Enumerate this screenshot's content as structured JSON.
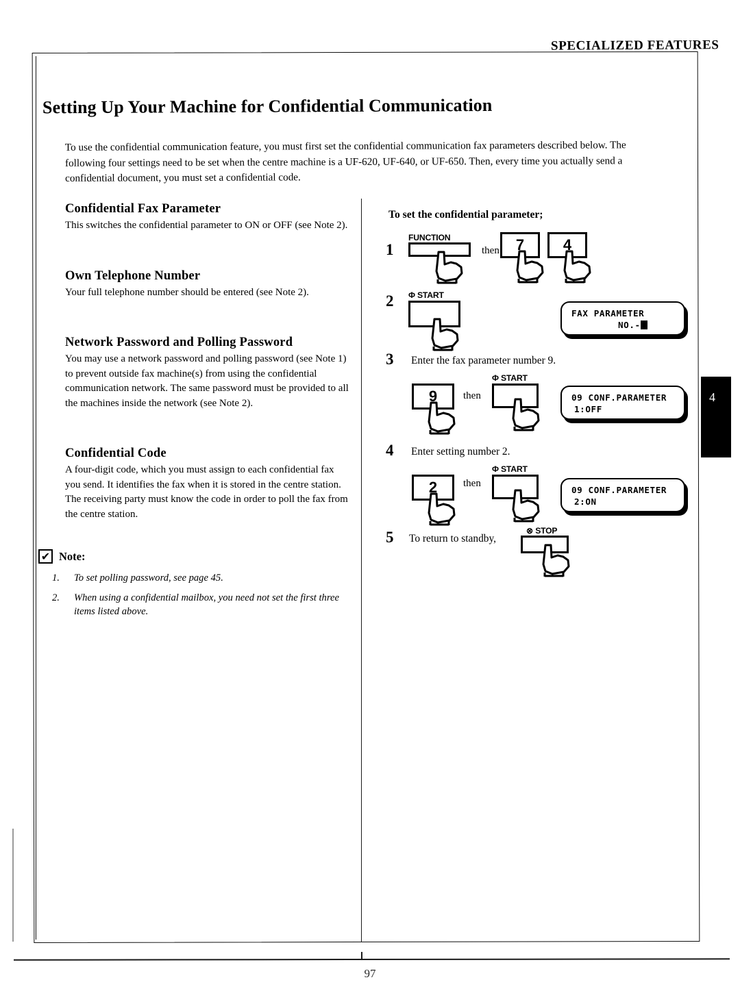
{
  "running_head": "SPECIALIZED FEATURES",
  "page_number": "97",
  "edge_tab": {
    "label": "4"
  },
  "doc": {
    "title": "Setting Up Your Machine for Confidential Communication",
    "intro": "To use the confidential communication feature, you must first set the confidential communication fax parameters described below.  The following four settings need to be set when the centre machine is a UF-620, UF-640, or UF-650.  Then, every time you actually send a confidential document, you must set a confidential code."
  },
  "left_column": {
    "sections": [
      {
        "heading": "Confidential Fax Parameter",
        "body": "This switches the confidential parameter to ON or OFF (see Note 2)."
      },
      {
        "heading": "Own Telephone Number",
        "body": "Your full telephone number should be entered (see Note 2)."
      },
      {
        "heading": "Network Password and Polling Password",
        "body": "You may use a network password and polling password (see Note 1) to prevent outside fax machine(s) from using the confidential communication network.  The same password must be provided to all the machines inside the network (see Note 2)."
      },
      {
        "heading": "Confidential Code",
        "body": "A four-digit code, which you must assign to each confidential fax you send.  It identifies the fax when it is stored in the centre station.  The receiving party must know the code in order to poll the fax from the centre station."
      }
    ],
    "note": {
      "check_glyph": "✔",
      "label": "Note:",
      "items": [
        {
          "num": "1.",
          "text": "To set polling password, see page 45."
        },
        {
          "num": "2.",
          "text": "When using a confidential mailbox, you need not set the first three items listed above."
        }
      ]
    }
  },
  "procedure": {
    "heading": "To set the confidential parameter;",
    "then_label": "then",
    "steps": [
      {
        "num": "1",
        "text": "",
        "keys": [
          {
            "cap": "FUNCTION",
            "face": ""
          },
          {
            "cap": "",
            "face": "7"
          },
          {
            "cap": "",
            "face": "4"
          }
        ]
      },
      {
        "num": "2",
        "text": "",
        "keys": [
          {
            "cap": "Φ START",
            "face": ""
          }
        ],
        "lcd": {
          "line1": "FAX PARAMETER",
          "line2": "NO.-",
          "cursor": true
        }
      },
      {
        "num": "3",
        "text": "Enter the fax parameter number 9.",
        "keys": [
          {
            "cap": "",
            "face": "9"
          },
          {
            "cap": "Φ START",
            "face": ""
          }
        ],
        "lcd": {
          "line1": "09 CONF.PARAMETER",
          "line2": "1:OFF",
          "cursor": false
        }
      },
      {
        "num": "4",
        "text": "Enter setting number 2.",
        "keys": [
          {
            "cap": "",
            "face": "2"
          },
          {
            "cap": "Φ START",
            "face": ""
          }
        ],
        "lcd": {
          "line1": "09 CONF.PARAMETER",
          "line2": "2:ON",
          "cursor": false
        }
      },
      {
        "num": "5",
        "text": "To return to standby,",
        "keys": [
          {
            "cap": "⊗ STOP",
            "face": ""
          }
        ]
      }
    ]
  },
  "colors": {
    "ink": "#000000",
    "rule": "#1a1a1a",
    "tab_bg": "#000000",
    "tab_fg": "#ffffff"
  }
}
